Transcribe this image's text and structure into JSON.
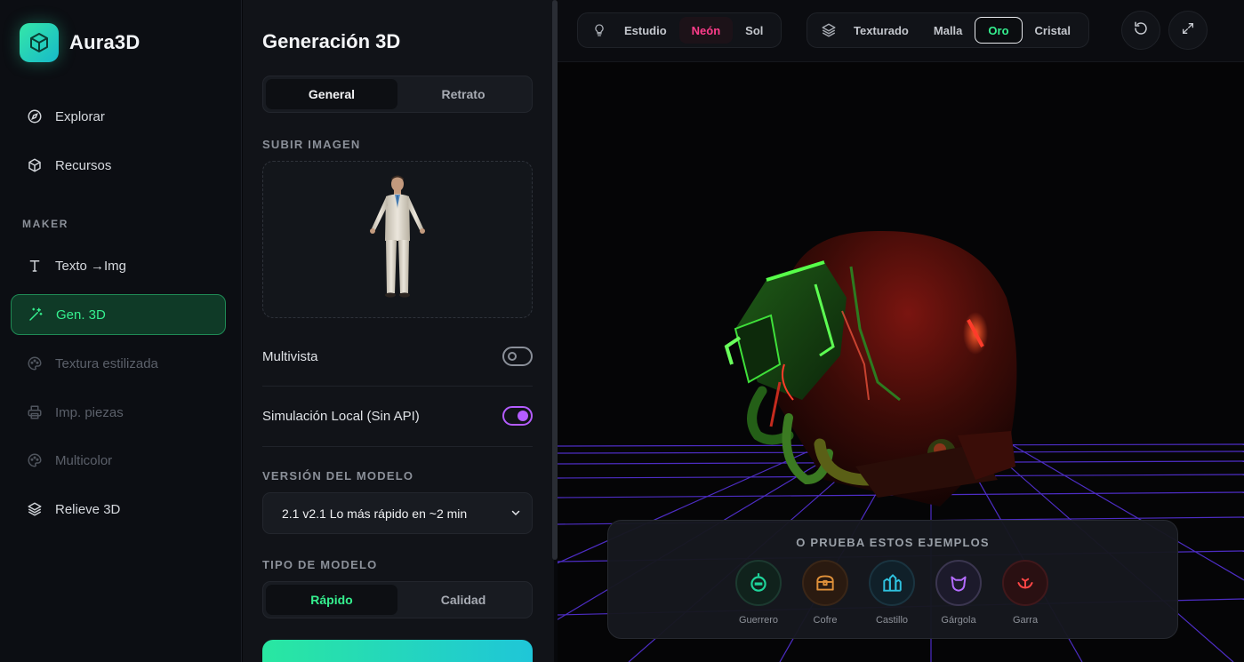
{
  "app": {
    "name": "Aura3D"
  },
  "sidebar": {
    "items": [
      {
        "label": "Explorar",
        "icon": "compass-icon"
      },
      {
        "label": "Recursos",
        "icon": "box-icon"
      }
    ],
    "section_label": "MAKER",
    "maker_items": [
      {
        "label": "Texto →Img",
        "icon": "text-icon"
      },
      {
        "label": "Gen. 3D",
        "icon": "magic-wand-icon",
        "active": true
      },
      {
        "label": "Textura estilizada",
        "icon": "palette-icon",
        "disabled": true
      },
      {
        "label": "Imp. piezas",
        "icon": "printer-icon",
        "disabled": true
      },
      {
        "label": "Multicolor",
        "icon": "palette-icon",
        "disabled": true
      },
      {
        "label": "Relieve 3D",
        "icon": "layers-icon"
      }
    ]
  },
  "panel": {
    "title": "Generación 3D",
    "mode_tabs": [
      {
        "label": "General",
        "selected": true
      },
      {
        "label": "Retrato",
        "selected": false
      }
    ],
    "upload_label": "SUBIR IMAGEN",
    "toggles": [
      {
        "label": "Multivista",
        "on": false
      },
      {
        "label": "Simulación Local (Sin API)",
        "on": true
      }
    ],
    "model_version_label": "VERSIÓN DEL MODELO",
    "model_version_value": "2.1 v2.1 Lo más rápido en ~2 min",
    "model_type_label": "TIPO DE MODELO",
    "model_type_tabs": [
      {
        "label": "Rápido",
        "selected": true
      },
      {
        "label": "Calidad",
        "selected": false
      }
    ]
  },
  "viewer": {
    "lighting_options": [
      {
        "label": "Estudio",
        "selected": false
      },
      {
        "label": "Neón",
        "selected": true
      },
      {
        "label": "Sol",
        "selected": false
      }
    ],
    "material_options": [
      {
        "label": "Texturado",
        "selected": false
      },
      {
        "label": "Malla",
        "selected": false
      },
      {
        "label": "Oro",
        "selected": true
      },
      {
        "label": "Cristal",
        "selected": false
      }
    ],
    "examples_title": "O PRUEBA ESTOS EJEMPLOS",
    "examples": [
      {
        "label": "Guerrero",
        "color": "#1ed49a"
      },
      {
        "label": "Cofre",
        "color": "#e0913a"
      },
      {
        "label": "Castillo",
        "color": "#2fc3e0"
      },
      {
        "label": "Gárgola",
        "color": "#b46cff"
      },
      {
        "label": "Garra",
        "color": "#ff4646"
      }
    ]
  },
  "colors": {
    "accent_green": "#35f08f",
    "neon_pink": "#ff3d8b",
    "toggle_purple": "#b45cff",
    "grid_purple": "#6a3cff"
  }
}
